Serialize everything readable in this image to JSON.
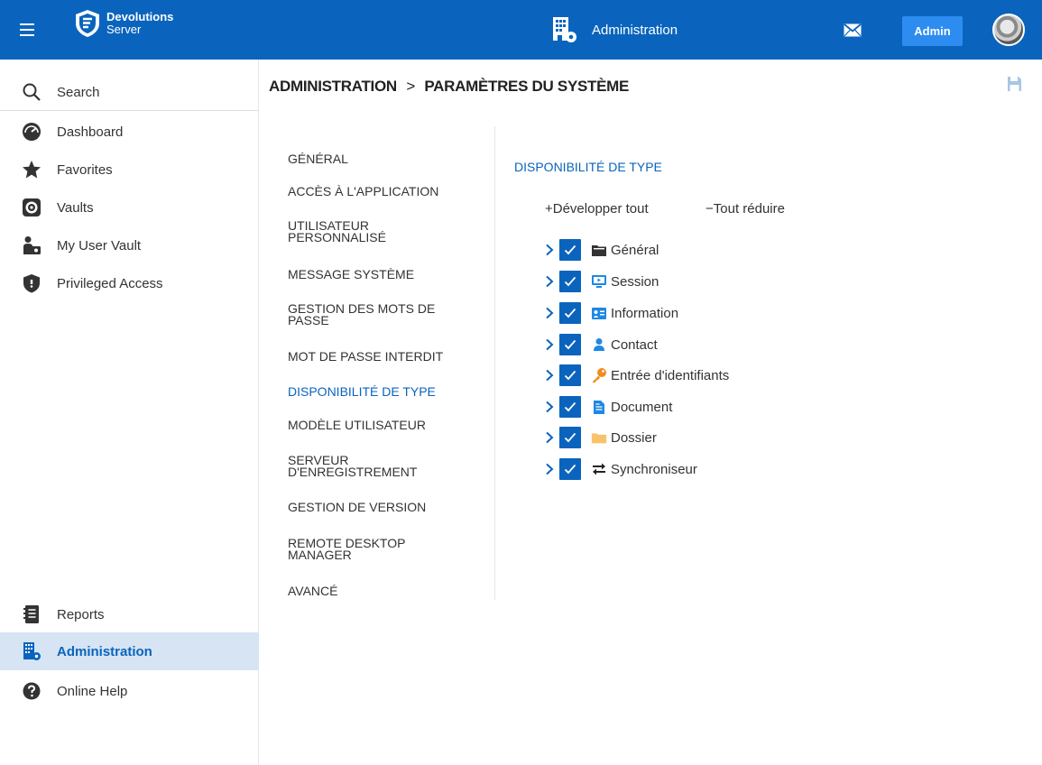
{
  "topbar": {
    "logo_line1": "Devolutions",
    "logo_line2": "Server",
    "center_title": "Administration",
    "user_button": "Admin",
    "colors": {
      "bar": "#0a64bd",
      "button": "#2d8cf0"
    }
  },
  "sidebar": {
    "items": [
      {
        "label": "Search",
        "icon": "search-icon"
      },
      {
        "label": "Dashboard",
        "icon": "dashboard-icon"
      },
      {
        "label": "Favorites",
        "icon": "star-icon"
      },
      {
        "label": "Vaults",
        "icon": "vault-icon"
      },
      {
        "label": "My User Vault",
        "icon": "user-vault-icon"
      },
      {
        "label": "Privileged Access",
        "icon": "shield-icon"
      },
      {
        "label": "Reports",
        "icon": "reports-icon"
      },
      {
        "label": "Administration",
        "icon": "administration-icon",
        "active": true
      },
      {
        "label": "Online Help",
        "icon": "help-icon"
      }
    ]
  },
  "breadcrumb": {
    "part1": "ADMINISTRATION",
    "separator": ">",
    "part2": "PARAMÈTRES DU SYSTÈME"
  },
  "settings_nav": {
    "items": [
      {
        "line1": "GÉNÉRAL",
        "line2": ""
      },
      {
        "line1": "ACCÈS À L'APPLICATION",
        "line2": ""
      },
      {
        "line1": "UTILISATEUR",
        "line2": "PERSONNALISÉ"
      },
      {
        "line1": "MESSAGE SYSTÈME",
        "line2": ""
      },
      {
        "line1": "GESTION DES MOTS DE",
        "line2": "PASSE"
      },
      {
        "line1": "MOT DE PASSE INTERDIT",
        "line2": ""
      },
      {
        "line1": "DISPONIBILITÉ DE TYPE",
        "line2": "",
        "active": true
      },
      {
        "line1": "MODÈLE UTILISATEUR",
        "line2": ""
      },
      {
        "line1": "SERVEUR",
        "line2": "D'ENREGISTREMENT"
      },
      {
        "line1": "GESTION DE VERSION",
        "line2": ""
      },
      {
        "line1": "REMOTE DESKTOP",
        "line2": "MANAGER"
      },
      {
        "line1": "AVANCÉ",
        "line2": ""
      }
    ]
  },
  "panel": {
    "title": "DISPONIBILITÉ DE TYPE",
    "expand_all": "+Développer tout",
    "collapse_all": "−Tout réduire",
    "tree": [
      {
        "label": "Général",
        "icon": "folder-dark-icon",
        "checked": true
      },
      {
        "label": "Session",
        "icon": "session-icon",
        "checked": true
      },
      {
        "label": "Information",
        "icon": "information-card-icon",
        "checked": true
      },
      {
        "label": "Contact",
        "icon": "contact-icon",
        "checked": true
      },
      {
        "label": "Entrée d'identifiants",
        "icon": "key-icon",
        "checked": true
      },
      {
        "label": "Document",
        "icon": "document-icon",
        "checked": true
      },
      {
        "label": "Dossier",
        "icon": "folder-icon",
        "checked": true
      },
      {
        "label": "Synchroniseur",
        "icon": "sync-icon",
        "checked": true
      }
    ]
  }
}
